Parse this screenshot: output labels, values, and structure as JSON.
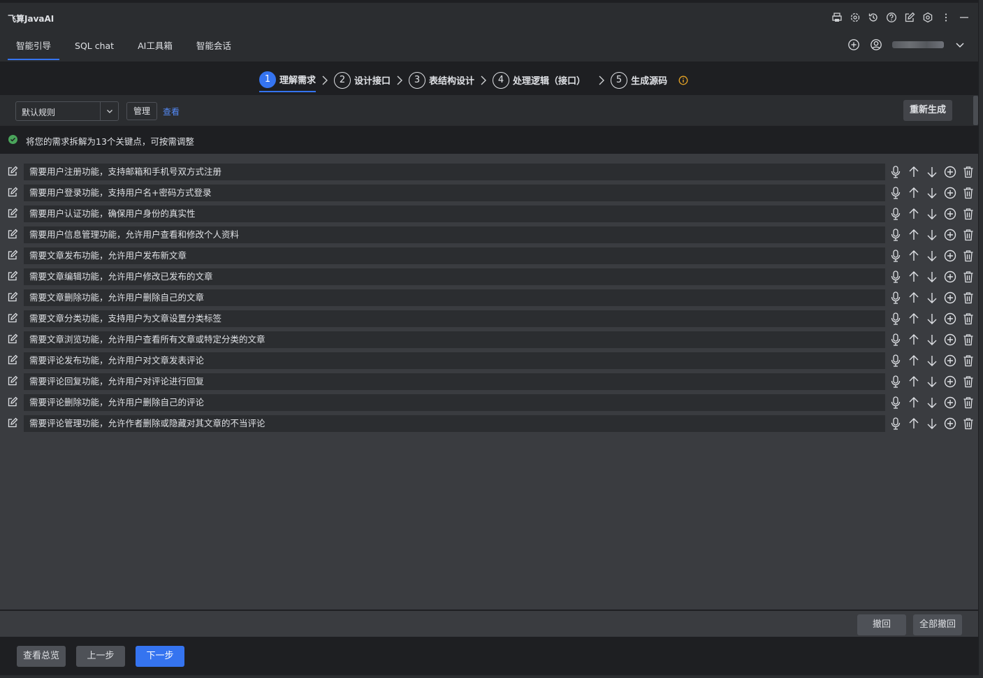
{
  "app": {
    "title": "飞算JavaAI"
  },
  "title_icons": [
    "printer-icon",
    "refresh-settings-icon",
    "history-icon",
    "help-icon",
    "edit-icon",
    "settings-icon",
    "more-icon",
    "minimize-icon"
  ],
  "tabs": [
    {
      "label": "智能引导",
      "active": true
    },
    {
      "label": "SQL chat",
      "active": false
    },
    {
      "label": "AI工具箱",
      "active": false
    },
    {
      "label": "智能会话",
      "active": false
    }
  ],
  "steps": [
    {
      "num": "1",
      "label": "理解需求",
      "active": true
    },
    {
      "num": "2",
      "label": "设计接口",
      "active": false
    },
    {
      "num": "3",
      "label": "表结构设计",
      "active": false
    },
    {
      "num": "4",
      "label": "处理逻辑（接口）",
      "active": false
    },
    {
      "num": "5",
      "label": "生成源码",
      "active": false
    }
  ],
  "toolbar": {
    "rule_select": "默认规则",
    "manage": "管理",
    "view": "查看",
    "regenerate": "重新生成"
  },
  "notice": "将您的需求拆解为13个关键点，可按需调整",
  "requirements": [
    "需要用户注册功能，支持邮箱和手机号双方式注册",
    "需要用户登录功能，支持用户名+密码方式登录",
    "需要用户认证功能，确保用户身份的真实性",
    "需要用户信息管理功能，允许用户查看和修改个人资料",
    "需要文章发布功能，允许用户发布新文章",
    "需要文章编辑功能，允许用户修改已发布的文章",
    "需要文章删除功能，允许用户删除自己的文章",
    "需要文章分类功能，支持用户为文章设置分类标签",
    "需要文章浏览功能，允许用户查看所有文章或特定分类的文章",
    "需要评论发布功能，允许用户对文章发表评论",
    "需要评论回复功能，允许用户对评论进行回复",
    "需要评论删除功能，允许用户删除自己的评论",
    "需要评论管理功能，允许作者删除或隐藏对其文章的不当评论"
  ],
  "row_actions": [
    "mic-icon",
    "arrow-up-icon",
    "arrow-down-icon",
    "add-circle-icon",
    "delete-icon"
  ],
  "undo": {
    "undo": "撤回",
    "undo_all": "全部撤回"
  },
  "footer": {
    "overview": "查看总览",
    "prev": "上一步",
    "next": "下一步"
  },
  "colors": {
    "accent": "#3574f0",
    "success": "#4aa55b",
    "warning": "#e3a225"
  }
}
